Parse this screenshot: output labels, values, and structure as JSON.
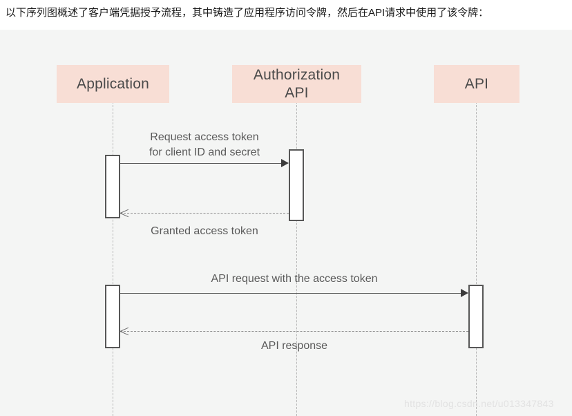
{
  "caption": {
    "text": "以下序列图概述了客户端凭据授予流程，其中铸造了应用程序访问令牌，然后在API请求中使用了该令牌："
  },
  "diagram": {
    "type": "sequence-diagram",
    "background_color": "#f4f5f4",
    "participant_box_color": "#f8ded5",
    "participants": [
      {
        "name": "application",
        "label": "Application"
      },
      {
        "name": "authorization-api",
        "label": "Authorization\nAPI"
      },
      {
        "name": "api",
        "label": "API"
      }
    ],
    "participant_labels": {
      "application": "Application",
      "authorization_api_line1": "Authorization",
      "authorization_api_line2": "API",
      "api": "API"
    },
    "messages": [
      {
        "name": "request-access-token",
        "from": "application",
        "to": "authorization-api",
        "style": "solid",
        "direction": "right",
        "label_line1": "Request access token",
        "label_line2": "for client ID and secret"
      },
      {
        "name": "granted-access-token",
        "from": "authorization-api",
        "to": "application",
        "style": "dashed",
        "direction": "left",
        "label_line1": "Granted access token",
        "label_line2": ""
      },
      {
        "name": "api-request-with-token",
        "from": "application",
        "to": "api",
        "style": "solid",
        "direction": "right",
        "label_line1": "API request with the access token",
        "label_line2": ""
      },
      {
        "name": "api-response",
        "from": "api",
        "to": "application",
        "style": "dashed",
        "direction": "left",
        "label_line1": "API response",
        "label_line2": ""
      }
    ]
  },
  "watermark": {
    "text": "https://blog.csdn.net/u013347843"
  }
}
